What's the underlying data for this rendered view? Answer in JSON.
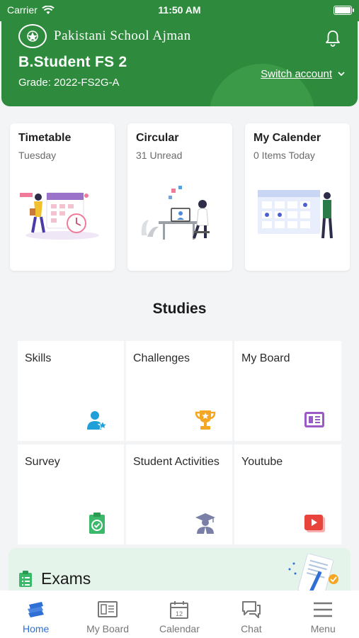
{
  "status": {
    "carrier": "Carrier",
    "time": "11:50 AM"
  },
  "header": {
    "school_name": "Pakistani School Ajman",
    "student_name": "B.Student FS 2",
    "grade": "Grade: 2022-FS2G-A",
    "switch_label": "Switch account"
  },
  "cards": [
    {
      "title": "Timetable",
      "subtitle": "Tuesday"
    },
    {
      "title": "Circular",
      "subtitle": "31 Unread"
    },
    {
      "title": "My Calender",
      "subtitle": "0 Items Today"
    }
  ],
  "studies": {
    "title": "Studies",
    "tiles": [
      {
        "label": "Skills",
        "icon": "user-star-icon"
      },
      {
        "label": "Challenges",
        "icon": "trophy-icon"
      },
      {
        "label": "My Board",
        "icon": "board-icon"
      },
      {
        "label": "Survey",
        "icon": "clipboard-check-icon"
      },
      {
        "label": "Student Activities",
        "icon": "graduate-icon"
      },
      {
        "label": "Youtube",
        "icon": "video-play-icon"
      }
    ]
  },
  "exams": {
    "label": "Exams"
  },
  "tabbar": [
    {
      "label": "Home",
      "icon": "books-icon",
      "active": true
    },
    {
      "label": "My Board",
      "icon": "board-icon"
    },
    {
      "label": "Calendar",
      "icon": "calendar-icon"
    },
    {
      "label": "Chat",
      "icon": "chat-icon"
    },
    {
      "label": "Menu",
      "icon": "menu-icon"
    }
  ],
  "colors": {
    "brand": "#2e8b3d",
    "accent_blue": "#2f6fd6",
    "exams_bg": "#e5f4ea"
  }
}
